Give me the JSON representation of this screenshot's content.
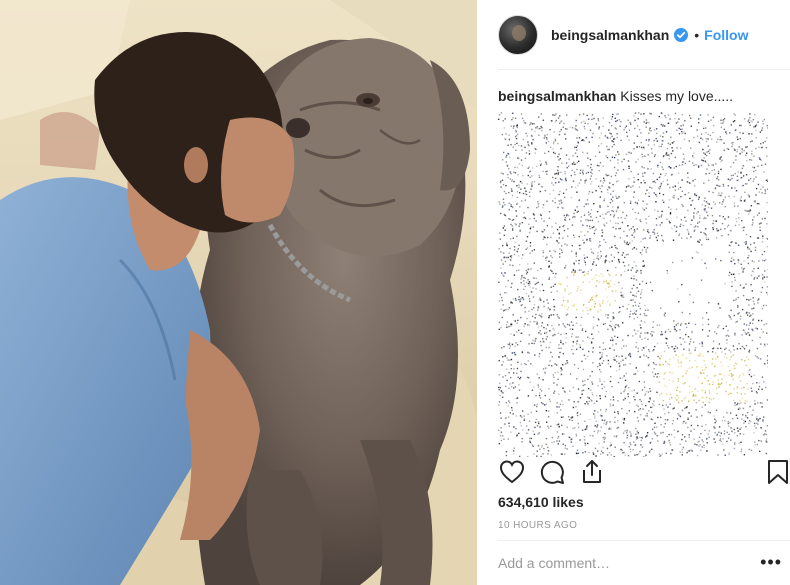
{
  "post": {
    "username": "beingsalmankhan",
    "follow_label": "Follow",
    "separator": "•",
    "caption_user": "beingsalmankhan",
    "caption_text": "Kisses my love.....",
    "likes": "634,610 likes",
    "timestamp": "10 HOURS AGO",
    "comment_placeholder": "Add a comment…",
    "more_label": "•••"
  },
  "icons": [
    "verified-badge-icon",
    "heart-icon",
    "comment-icon",
    "share-icon",
    "bookmark-icon"
  ],
  "colors": {
    "accent": "#3897f0",
    "text": "#262626",
    "muted": "#999999",
    "divider": "#efefef"
  }
}
